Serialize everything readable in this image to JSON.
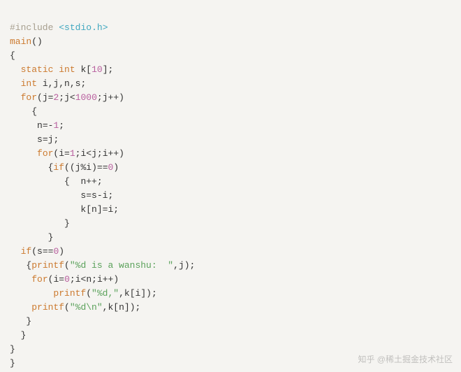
{
  "code": {
    "line1": {
      "include_kw": "#include",
      "sp": " ",
      "lt": "<",
      "hdr": "stdio",
      "dot": ".",
      "ext": "h",
      "gt": ">"
    },
    "line2": {
      "main": "main",
      "paren": "()"
    },
    "line3": "{",
    "line4": {
      "indent": "  ",
      "static_kw": "static",
      "sp1": " ",
      "int_kw": "int",
      "sp2": " ",
      "arr": "k",
      "lb": "[",
      "size": "10",
      "rb": "]",
      "semi": ";"
    },
    "line5": {
      "indent": "  ",
      "int_kw": "int",
      "sp": " ",
      "vars": "i,j,n,s",
      "semi": ";"
    },
    "line6": {
      "indent": "  ",
      "for_kw": "for",
      "open": "(",
      "a": "j",
      "eq": "=",
      "v1": "2",
      "semi1": ";",
      "b": "j",
      "lt": "<",
      "v2": "1000",
      "semi2": ";",
      "c": "j",
      "inc": "++",
      "close": ")"
    },
    "line7": {
      "indent": "    ",
      "brace": "{"
    },
    "line8": {
      "indent": "     ",
      "lhs": "n",
      "eq": "=",
      "neg": "-",
      "one": "1",
      "semi": ";"
    },
    "line9": {
      "indent": "     ",
      "lhs": "s",
      "eq": "=",
      "rhs": "j",
      "semi": ";"
    },
    "line10": {
      "indent": "     ",
      "for_kw": "for",
      "open": "(",
      "a": "i",
      "eq": "=",
      "v1": "1",
      "semi1": ";",
      "b": "i",
      "lt": "<",
      "b2": "j",
      "semi2": ";",
      "c": "i",
      "inc": "++",
      "close": ")"
    },
    "line11": {
      "indent": "       ",
      "brace": "{",
      "if_kw": "if",
      "open": "((",
      "a": "j",
      "mod": "%",
      "b": "i",
      "close": ")",
      "eqeq": "==",
      "zero": "0",
      "close2": ")"
    },
    "line12": {
      "indent": "          ",
      "brace": "{",
      "sp": "  ",
      "a": "n",
      "inc": "++",
      "semi": ";"
    },
    "line13": {
      "indent": "             ",
      "a": "s",
      "eq": "=",
      "b": "s",
      "minus": "-",
      "c": "i",
      "semi": ";"
    },
    "line14": {
      "indent": "             ",
      "a": "k",
      "lb": "[",
      "idx": "n",
      "rb": "]",
      "eq": "=",
      "c": "i",
      "semi": ";"
    },
    "line15": {
      "indent": "          ",
      "brace": "}"
    },
    "line16": {
      "indent": "       ",
      "brace": "}"
    },
    "line17": {
      "indent": "  ",
      "if_kw": "if",
      "open": "(",
      "a": "s",
      "eqeq": "==",
      "zero": "0",
      "close": ")"
    },
    "line18": {
      "indent": "   ",
      "brace": "{",
      "fn": "printf",
      "open": "(",
      "str": "\"%d is a wanshu:  \"",
      "comma": ",",
      "arg": "j",
      "close": ")",
      "semi": ";"
    },
    "line19": {
      "indent": "    ",
      "for_kw": "for",
      "open": "(",
      "a": "i",
      "eq": "=",
      "zero": "0",
      "semi1": ";",
      "b": "i",
      "lt": "<",
      "c": "n",
      "semi2": ";",
      "d": "i",
      "inc": "++",
      "close": ")"
    },
    "line20": {
      "indent": "        ",
      "fn": "printf",
      "open": "(",
      "str": "\"%d,\"",
      "comma": ",",
      "a": "k",
      "lb": "[",
      "idx": "i",
      "rb": "]",
      "close": ")",
      "semi": ";"
    },
    "line21": {
      "indent": "    ",
      "fn": "printf",
      "open": "(",
      "str": "\"%d\\n\"",
      "comma": ",",
      "a": "k",
      "lb": "[",
      "idx": "n",
      "rb": "]",
      "close": ")",
      "semi": ";"
    },
    "line22": {
      "indent": "   ",
      "brace": "}"
    },
    "line23": {
      "indent": "  ",
      "brace": "}"
    },
    "line24": "}",
    "line25": "}"
  },
  "watermark": "知乎 @稀土掘金技术社区"
}
